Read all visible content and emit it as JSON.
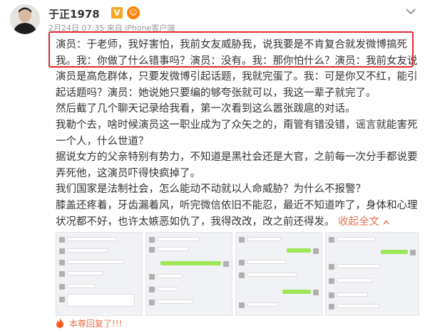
{
  "user": {
    "name": "于正1978",
    "verified_icon": "verified-v-icon",
    "verified_glyph": "V",
    "member_icon": "member-crown-icon",
    "member_glyph": "☺",
    "post_meta": "2月24日 07:35 来自 iPhone客户端"
  },
  "menu_icon": "chevron-down-icon",
  "post": {
    "lines": [
      "演员：于老师，我好害怕，我前女友威胁我，说我要是不肯复合就发微博搞死",
      "我。我：你做了什么错事吗？演员：没有。我：那你怕什么？演员：我前女友说",
      "演员是高危群体，只要发微博引起话题，我就完蛋了。我：可是你又不红，能引",
      "起话题吗？演员：她说她只要编的够夸张就可以，我这一辈子就完了。",
      "然后截了几个聊天记录给我看，第一次看到这么嚣张跋扈的对话。",
      "我勒个去，啥时候演员这一职业成为了众矢之的，甭管有错没错，谣言就能害死",
      "一个人，什么世道？",
      "据说女方的父亲特别有势力，不知道是黑社会还是大官，之前每一次分手都说要",
      "弄死他，这演员吓得快疯掉了。",
      "我们国家是法制社会，怎么能动不动就以人命威胁？为什么不报警？",
      "膝盖还疼着，牙齿漏着风，听完微信依旧不能忍，最近不知道咋了，身体和心理"
    ],
    "last_line": "状况都不好，也许太嫉恶如仇了，我得改改，改之前还得发。",
    "collapse_label": "收起全文",
    "collapse_icon": "chevron-up-icon"
  },
  "images": {
    "count": 4,
    "icon": "chat-screenshot-image"
  },
  "footer": {
    "icon": "fire-icon",
    "label": "本尊回复了!!!"
  },
  "colors": {
    "highlight_border": "#e0282b",
    "link": "#eb7350",
    "wechat_green": "#9fe658"
  }
}
